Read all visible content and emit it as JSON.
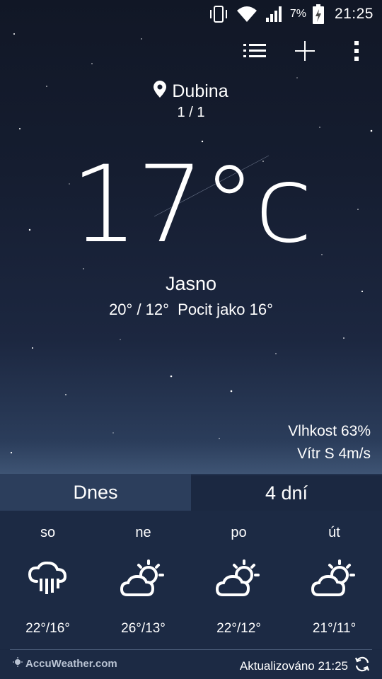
{
  "status_bar": {
    "battery_percent": "7%",
    "time": "21:25",
    "icons": [
      "vibrate-icon",
      "wifi-icon",
      "signal-icon",
      "battery-charging-icon"
    ]
  },
  "toolbar": {
    "icons": [
      "list-icon",
      "add-icon",
      "more-vert-icon"
    ]
  },
  "location": {
    "name": "Dubina",
    "page": "1 / 1"
  },
  "current": {
    "temperature": "17°c",
    "condition": "Jasno",
    "minmax_feels": "20° / 12°  Pocit jako 16°",
    "humidity": "Vlhkost 63%",
    "wind": "Vítr S 4m/s"
  },
  "tabs": [
    {
      "label": "Dnes"
    },
    {
      "label": "4 dní"
    }
  ],
  "forecast": [
    {
      "day": "so",
      "icon": "rain-cloud-icon",
      "temps": "22°/16°"
    },
    {
      "day": "ne",
      "icon": "partly-cloudy-icon",
      "temps": "26°/13°"
    },
    {
      "day": "po",
      "icon": "partly-cloudy-icon",
      "temps": "22°/12°"
    },
    {
      "day": "út",
      "icon": "partly-cloudy-icon",
      "temps": "21°/11°"
    }
  ],
  "footer": {
    "brand": "AccuWeather.com",
    "updated": "Aktualizováno 21:25"
  },
  "colors": {
    "sky_top": "#111726",
    "sky_bottom": "#3f5575",
    "panel": "#1c2a44",
    "tab_today": "#2c3e5c"
  }
}
